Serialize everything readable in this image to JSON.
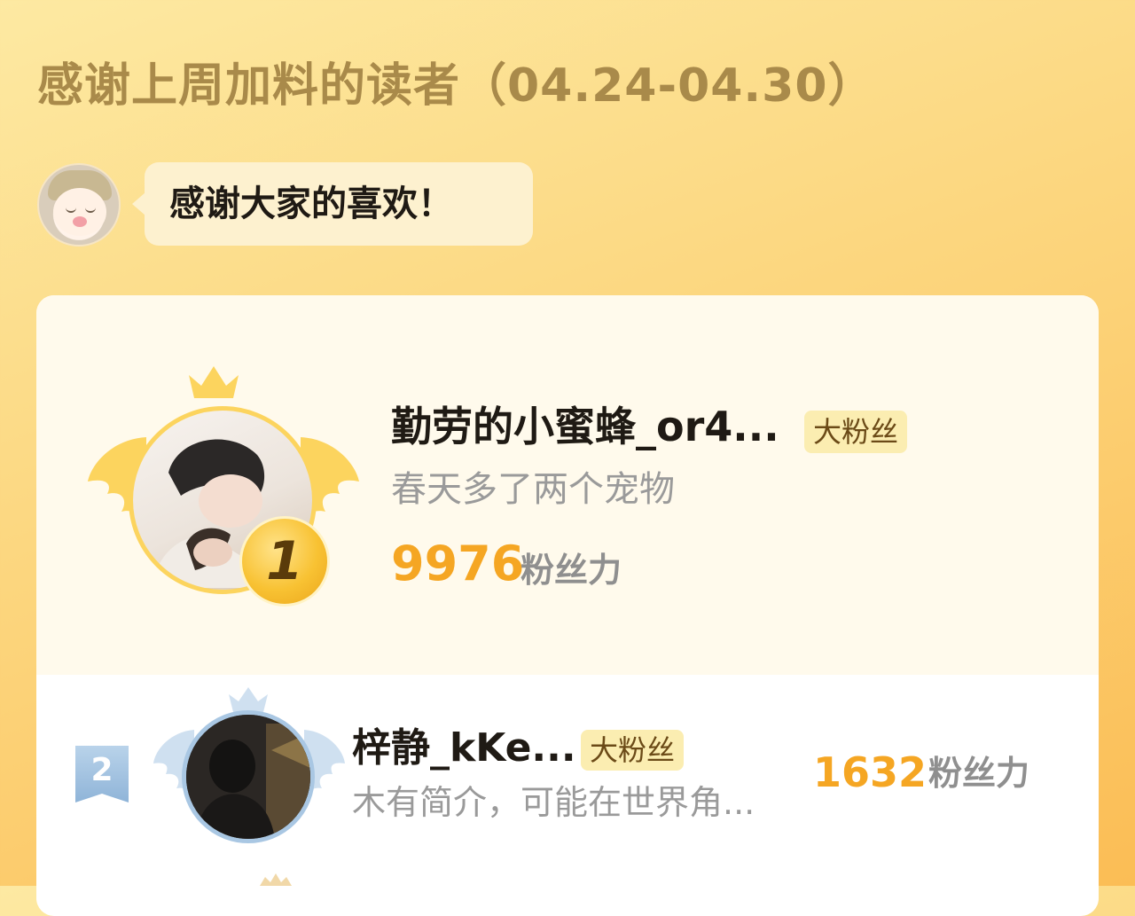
{
  "header": {
    "title": "感谢上周加料的读者（04.24-04.30）"
  },
  "greeting": {
    "message": "感谢大家的喜欢！"
  },
  "ranking": [
    {
      "rank": "1",
      "name": "勤劳的小蜜蜂_or4...",
      "tag": "大粉丝",
      "bio": "春天多了两个宠物",
      "score": "9976",
      "unit": "粉丝力"
    },
    {
      "rank": "2",
      "name": "梓静_kKe...",
      "tag": "大粉丝",
      "bio": "木有简介，可能在世界角...",
      "score": "1632",
      "unit": "粉丝力"
    }
  ],
  "colors": {
    "gold": "#f5a623",
    "silver": "#a9c7e3",
    "tag_bg": "#fbedb1"
  }
}
